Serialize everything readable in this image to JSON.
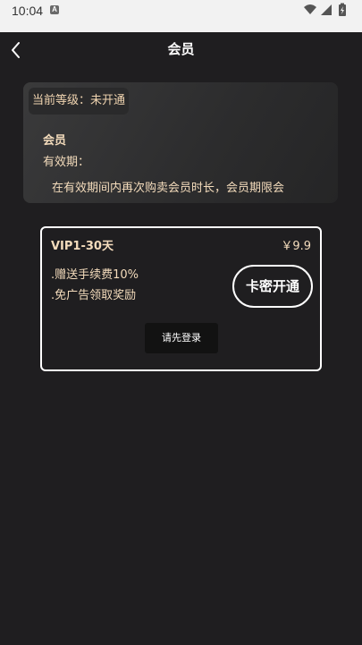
{
  "status_bar": {
    "time": "10:04",
    "notification_glyph": "A",
    "icons": [
      "wifi-icon",
      "signal-icon",
      "battery-charging-icon"
    ]
  },
  "header": {
    "title": "会员",
    "back_icon": "chevron-left-icon"
  },
  "level_card": {
    "level_text": "当前等级：未开通",
    "member_title": "会员",
    "validity_text": "有效期：",
    "notice_text": "在有效期间内再次购卖会员时长，会员期限会"
  },
  "plan": {
    "name": "VIP1-30天",
    "price": "￥9.9",
    "benefits": [
      ".赠送手续费10%",
      ".免广告领取奖励"
    ],
    "activate_label": "卡密开通",
    "login_label": "请先登录"
  },
  "colors": {
    "background": "#1f1e20",
    "accent_text": "#f4dcbc",
    "status_bar_bg": "#f2f2f2"
  }
}
